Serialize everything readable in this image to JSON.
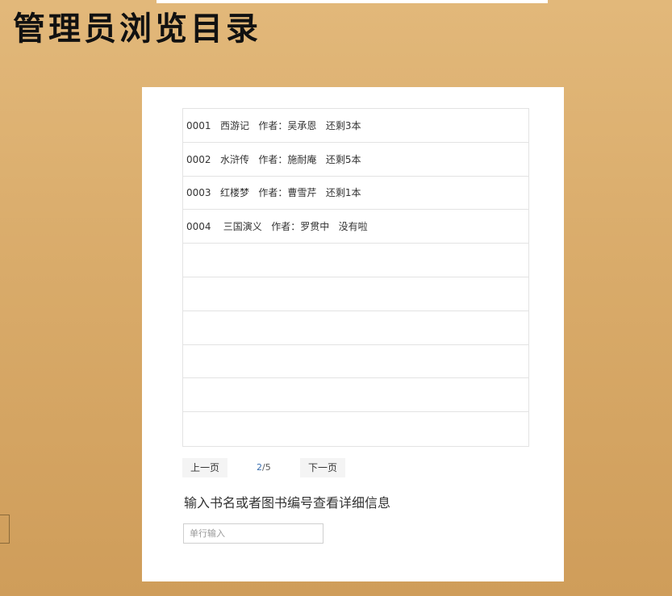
{
  "app": {
    "title": "管理员浏览目录"
  },
  "books": [
    {
      "text": "0001   西游记   作者：吴承恩   还剩3本"
    },
    {
      "text": "0002   水浒传   作者：施耐庵   还剩5本"
    },
    {
      "text": "0003   红楼梦   作者：曹雪芹   还剩1本"
    },
    {
      "text": "0004    三国演义   作者：罗贯中   没有啦"
    },
    {
      "text": ""
    },
    {
      "text": ""
    },
    {
      "text": ""
    },
    {
      "text": ""
    },
    {
      "text": ""
    },
    {
      "text": ""
    }
  ],
  "pager": {
    "prev_label": "上一页",
    "current_page": "2",
    "total_pages": "/5",
    "next_label": "下一页"
  },
  "search": {
    "heading": "输入书名或者图书编号查看详细信息",
    "placeholder": "单行输入",
    "value": ""
  },
  "colors": {
    "background": "#dcae6e",
    "panel": "#ffffff",
    "page_indicator_accent": "#3a6fb0"
  }
}
